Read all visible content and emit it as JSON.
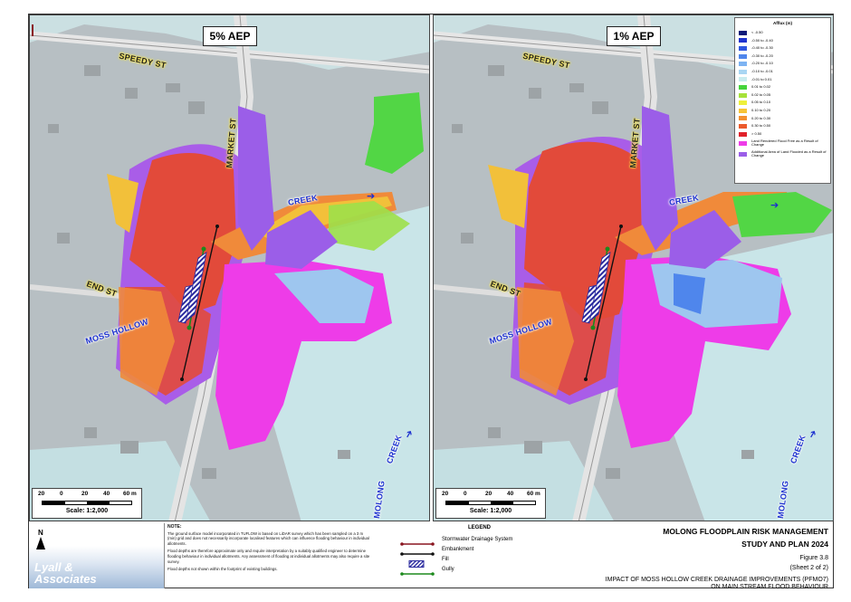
{
  "maps": [
    {
      "aep_label": "5% AEP",
      "labels": {
        "speedy_st": "SPEEDY ST",
        "market_st": "MARKET ST",
        "creek_upper": "CREEK",
        "end_st": "END ST",
        "moss_hollow": "MOSS HOLLOW",
        "creek_lower": "CREEK",
        "molong": "MOLONG"
      }
    },
    {
      "aep_label": "1% AEP",
      "labels": {
        "speedy_st": "SPEEDY ST",
        "market_st": "MARKET ST",
        "creek_upper": "CREEK",
        "end_st": "END ST",
        "moss_hollow": "MOSS HOLLOW",
        "creek_lower": "CREEK",
        "molong": "MOLONG"
      }
    }
  ],
  "scale": {
    "ticks": [
      "20",
      "0",
      "20",
      "40",
      "60 m"
    ],
    "label": "Scale: 1:2,000"
  },
  "afflux_legend": {
    "title": "Afflux (m)",
    "items": [
      {
        "color": "#0b1a78",
        "label": "< -0.50"
      },
      {
        "color": "#1f33cf",
        "label": "-0.50 to -0.40"
      },
      {
        "color": "#2f57e0",
        "label": "-0.40 to -0.30"
      },
      {
        "color": "#4f86ec",
        "label": "-0.30 to -0.20"
      },
      {
        "color": "#7db3f2",
        "label": "-0.20 to -0.10"
      },
      {
        "color": "#a9d6f3",
        "label": "-0.10 to -0.01"
      },
      {
        "color": "#c9ecef",
        "label": "-0.01 to 0.01"
      },
      {
        "color": "#45d43b",
        "label": "0.01 to 0.02"
      },
      {
        "color": "#a6e23a",
        "label": "0.02 to 0.05"
      },
      {
        "color": "#eef03a",
        "label": "0.05 to 0.10"
      },
      {
        "color": "#f7c436",
        "label": "0.10 to 0.20"
      },
      {
        "color": "#f49030",
        "label": "0.20 to 0.30"
      },
      {
        "color": "#ec5a2c",
        "label": "0.30 to 0.50"
      },
      {
        "color": "#e0202a",
        "label": "> 0.50"
      },
      {
        "color": "#ee3ce8",
        "label": "Land Rendered Flood Free as a Result of Change"
      },
      {
        "color": "#9b5ee8",
        "label": "Additional Area of Land Flooded as a Result of Change"
      }
    ]
  },
  "footer": {
    "north": "N",
    "logo_line1": "Lyall &",
    "logo_line2": "Associates",
    "note_title": "NOTE:",
    "notes": [
      "The ground surface model incorporated in TUFLOW is based on LiDAR survey which has been sampled on a 3 m (min) grid and does not necessarily incorporate localised features which can influence flooding behaviour in individual allotments.",
      "Flood depths are therefore approximate only and require interpretation by a suitably qualified engineer to determine flooding behaviour in individual allotments. Any assessment of flooding at individual allotments may also require a site survey.",
      "Flood depths not shown within the footprint of existing buildings."
    ],
    "legend_title": "LEGEND",
    "legend_items": [
      {
        "label": "Stormwater Drainage System",
        "color": "#8a1620",
        "kind": "line"
      },
      {
        "label": "Embankment",
        "color": "#111111",
        "kind": "line"
      },
      {
        "label": "Fill",
        "color": "#2a2a9e",
        "kind": "hatch"
      },
      {
        "label": "Gully",
        "color": "#1d8a1d",
        "kind": "line"
      }
    ],
    "title_line1": "MOLONG FLOODPLAIN RISK MANAGEMENT",
    "title_line2": "STUDY AND PLAN 2024",
    "figure": "Figure 3.8",
    "sheet": "(Sheet 2 of 2)",
    "desc_line1": "IMPACT OF MOSS HOLLOW CREEK DRAINAGE IMPROVEMENTS (PFMO7)",
    "desc_line2": "ON MAIN STREAM FLOOD BEHAVIOUR"
  }
}
